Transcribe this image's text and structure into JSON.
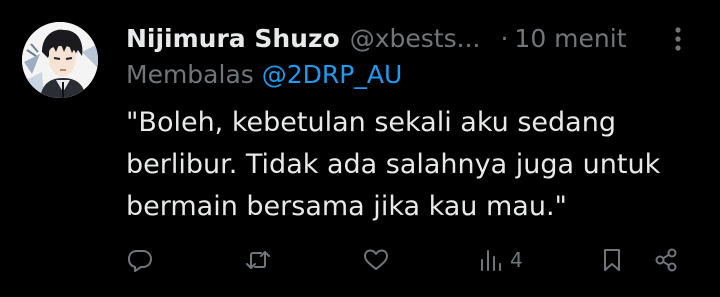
{
  "tweet": {
    "display_name": "Nijimura Shuzo",
    "handle": "@xbests...",
    "separator": "·",
    "time": "10 menit",
    "reply_prefix": "Membalas",
    "reply_to": "@2DRP_AU",
    "text": "\"Boleh, kebetulan sekali aku sedang\nberlibur. Tidak ada salahnya juga untuk\nbermain bersama jika kau mau.\"",
    "views": "4"
  },
  "colors": {
    "background": "#000000",
    "text_primary": "#e7e9ea",
    "text_secondary": "#71767b",
    "link": "#1d9bf0"
  },
  "icons": {
    "more": "more-vertical-icon",
    "reply": "reply-icon",
    "retweet": "retweet-icon",
    "like": "heart-icon",
    "views": "views-icon",
    "bookmark": "bookmark-icon",
    "share": "share-icon"
  }
}
